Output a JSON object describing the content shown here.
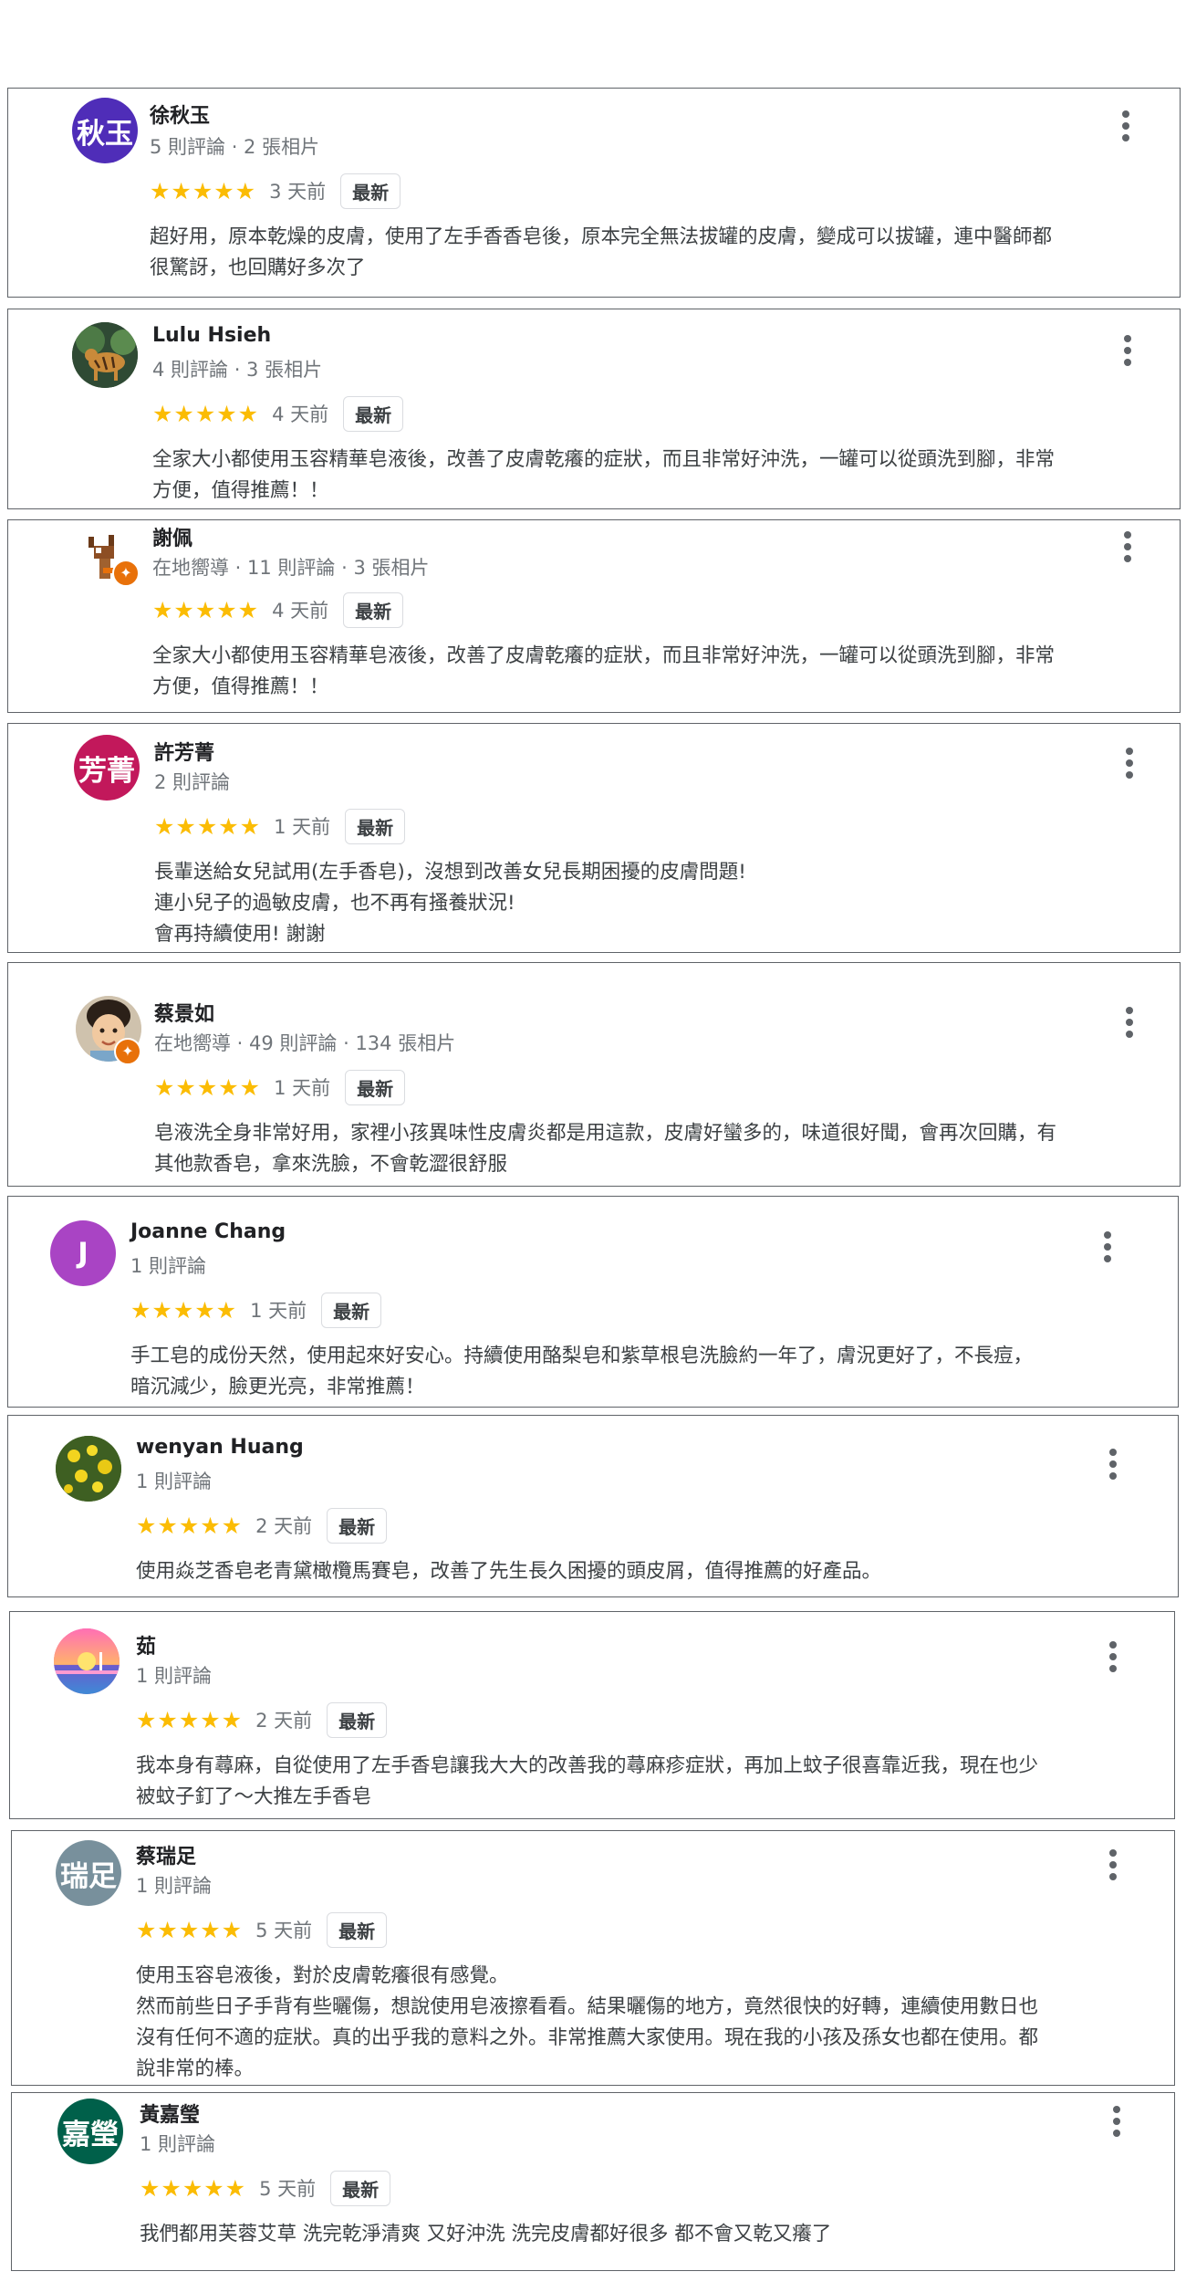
{
  "reviews": [
    {
      "name": "徐秋玉",
      "meta": "5 則評論 · 2 張相片",
      "avatar_text": "秋玉",
      "avatar_color": "#4f2db8",
      "stars": "★★★★★",
      "time": "3 天前",
      "tag": "最新",
      "text": "超好用，原本乾燥的皮膚，使用了左手香香皂後，原本完全無法拔罐的皮膚，變成可以拔罐，連中醫師都\n很驚訝，也回購好多次了"
    },
    {
      "name": "Lulu Hsieh",
      "meta": "4 則評論 · 3 張相片",
      "avatar_icon": "tiger-photo-avatar",
      "stars": "★★★★★",
      "time": "4 天前",
      "tag": "最新",
      "text": "全家大小都使用玉容精華皂液後，改善了皮膚乾癢的症狀，而且非常好沖洗，一罐可以從頭洗到腳，非常\n方便，值得推薦！！"
    },
    {
      "name": "謝佩",
      "meta": "在地嚮導 · 11 則評論 · 3 張相片",
      "avatar_icon": "deer-avatar",
      "stars": "★★★★★",
      "time": "4 天前",
      "tag": "最新",
      "text": "全家大小都使用玉容精華皂液後，改善了皮膚乾癢的症狀，而且非常好沖洗，一罐可以從頭洗到腳，非常\n方便，值得推薦！！"
    },
    {
      "name": "許芳菁",
      "meta": "2 則評論",
      "avatar_text": "芳菁",
      "avatar_color": "#c2185b",
      "stars": "★★★★★",
      "time": "1 天前",
      "tag": "最新",
      "text": "長輩送給女兒試用(左手香皂)，沒想到改善女兒長期困擾的皮膚問題!\n連小兒子的過敏皮膚，也不再有搔養狀況!\n會再持續使用! 謝謝"
    },
    {
      "name": "蔡景如",
      "meta": "在地嚮導 · 49 則評論 · 134 張相片",
      "avatar_icon": "child-photo-avatar",
      "stars": "★★★★★",
      "time": "1 天前",
      "tag": "最新",
      "text": "皂液洗全身非常好用，家裡小孩異味性皮膚炎都是用這款，皮膚好蠻多的，味道很好聞，會再次回購，有\n其他款香皂，拿來洗臉，不會乾澀很舒服"
    },
    {
      "name": "Joanne Chang",
      "meta": "1 則評論",
      "avatar_text": "J",
      "avatar_color": "#a944c4",
      "stars": "★★★★★",
      "time": "1 天前",
      "tag": "最新",
      "text": "手工皂的成份天然，使用起來好安心。持續使用酪梨皂和紫草根皂洗臉約一年了，膚況更好了，不長痘，\n暗沉減少，臉更光亮，非常推薦！"
    },
    {
      "name": "wenyan Huang",
      "meta": "1 則評論",
      "avatar_icon": "flower-photo-avatar",
      "stars": "★★★★★",
      "time": "2 天前",
      "tag": "最新",
      "text": "使用焱芝香皂老青黛橄欖馬賽皂，改善了先生長久困擾的頭皮屑，值得推薦的好產品。"
    },
    {
      "name": "茹",
      "meta": "1 則評論",
      "avatar_icon": "sunset-avatar",
      "stars": "★★★★★",
      "time": "2 天前",
      "tag": "最新",
      "text": "我本身有蕁麻，自從使用了左手香皂讓我大大的改善我的蕁麻疹症狀，再加上蚊子很喜靠近我，現在也少\n被蚊子釘了～大推左手香皂"
    },
    {
      "name": "蔡瑞足",
      "meta": "1 則評論",
      "avatar_text": "瑞足",
      "avatar_color": "#78909c",
      "stars": "★★★★★",
      "time": "5 天前",
      "tag": "最新",
      "text": "使用玉容皂液後，對於皮膚乾癢很有感覺。\n然而前些日子手背有些曬傷，想說使用皂液擦看看。結果曬傷的地方，竟然很快的好轉，連續使用數日也\n沒有任何不適的症狀。真的出乎我的意料之外。非常推薦大家使用。現在我的小孩及孫女也都在使用。都\n說非常的棒。"
    },
    {
      "name": "黃嘉瑩",
      "meta": "1 則評論",
      "avatar_text": "嘉瑩",
      "avatar_color": "#00604a",
      "stars": "★★★★★",
      "time": "5 天前",
      "tag": "最新",
      "text": "我們都用芙蓉艾草 洗完乾淨清爽 又好沖洗 洗完皮膚都好很多 都不會又乾又癢了"
    }
  ]
}
